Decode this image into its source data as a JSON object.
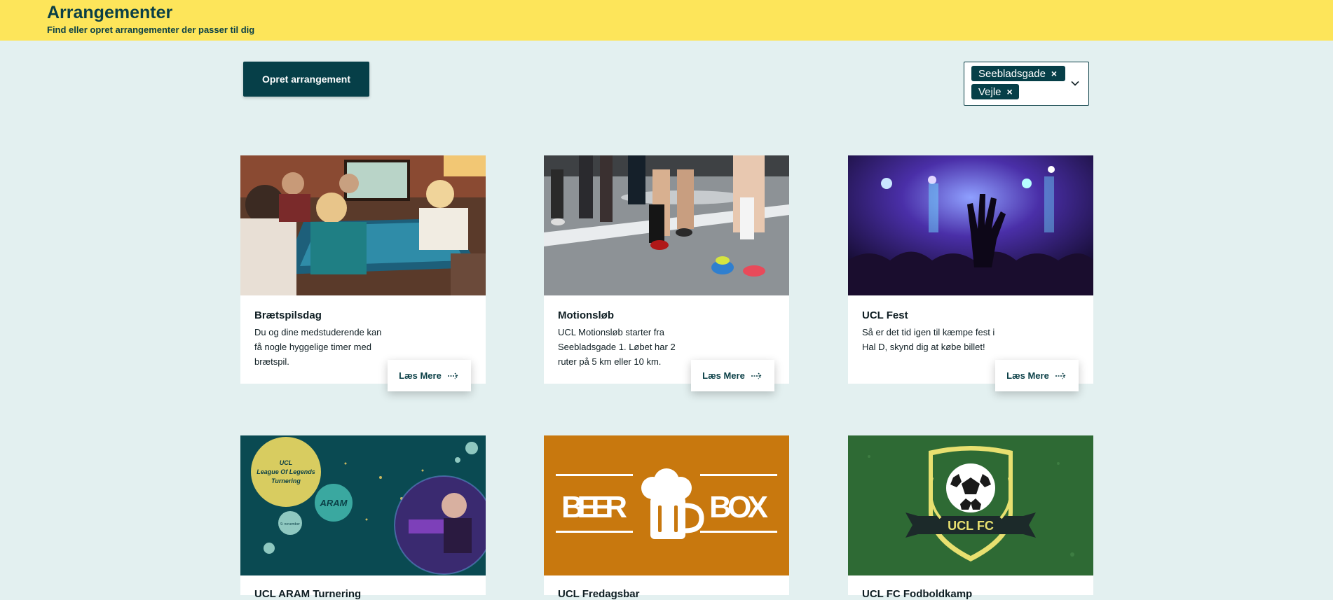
{
  "header": {
    "title": "Arrangementer",
    "subtitle": "Find eller opret arrangementer der passer til dig"
  },
  "toolbar": {
    "create_label": "Opret arrangement"
  },
  "filter": {
    "tags": [
      {
        "label": "Seebladsgade",
        "remove": "×"
      },
      {
        "label": "Vejle",
        "remove": "×"
      }
    ],
    "icon": "chevron-down-icon"
  },
  "cards": [
    {
      "title": "Brætspilsdag",
      "description": "Du og dine medstuderende kan få nogle hyggelige timer med brætspil.",
      "cta": "Læs Mere",
      "image": "board-game-photo"
    },
    {
      "title": "Motionsløb",
      "description": "UCL Motionsløb starter fra Seebladsgade 1. Løbet har 2 ruter på 5 km eller 10 km.",
      "cta": "Læs Mere",
      "image": "runners-photo"
    },
    {
      "title": "UCL Fest",
      "description": "Så er det tid igen til kæmpe fest i Hal D, skynd dig at købe billet!",
      "cta": "Læs Mere",
      "image": "concert-photo"
    },
    {
      "title": "UCL ARAM Turnering",
      "image": "aram-banner",
      "banner_text": {
        "line1": "UCL",
        "line2": "League Of Legends",
        "line3": "Turnering",
        "bubble": "ARAM",
        "date": "9. november"
      }
    },
    {
      "title": "UCL Fredagsbar",
      "image": "beerbox-banner",
      "banner_text": {
        "left": "BEER",
        "right": "BOX"
      }
    },
    {
      "title": "UCL FC Fodboldkamp",
      "image": "ucl-fc-badge",
      "banner_text": {
        "badge": "UCL FC"
      }
    }
  ]
}
